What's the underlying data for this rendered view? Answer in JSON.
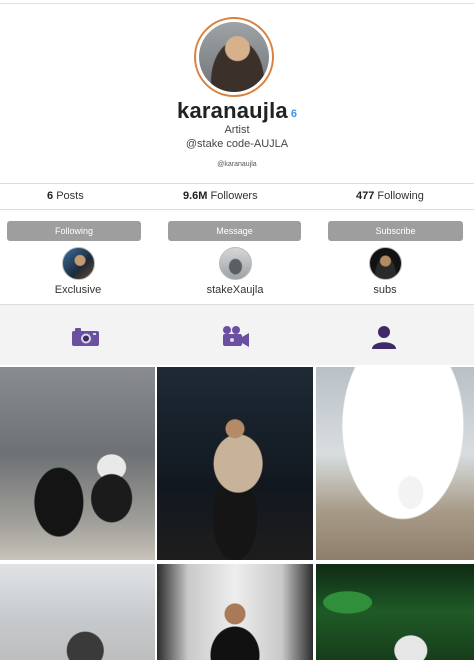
{
  "profile": {
    "username": "karanaujla",
    "verified_mark": "6",
    "category": "Artist",
    "bio": "@stake code-AUJLA",
    "handle_small": "@karanaujla"
  },
  "stats": {
    "posts_count": "6",
    "posts_label": "Posts",
    "followers_count": "9.6M",
    "followers_label": "Followers",
    "following_count": "477",
    "following_label": "Following"
  },
  "buttons": {
    "following": "Following",
    "message": "Message",
    "subscribe": "Subscribe"
  },
  "highlights": [
    {
      "label": "Exclusive"
    },
    {
      "label": "stakeXaujla"
    },
    {
      "label": "subs"
    }
  ],
  "tabs": [
    {
      "icon": "camera-icon"
    },
    {
      "icon": "video-camera-icon"
    },
    {
      "icon": "person-icon"
    }
  ],
  "colors": {
    "accent_ring": "#d9823f",
    "verified": "#3897f0",
    "tab_icon": "#5a3d8c",
    "button_bg": "#9e9e9e"
  }
}
